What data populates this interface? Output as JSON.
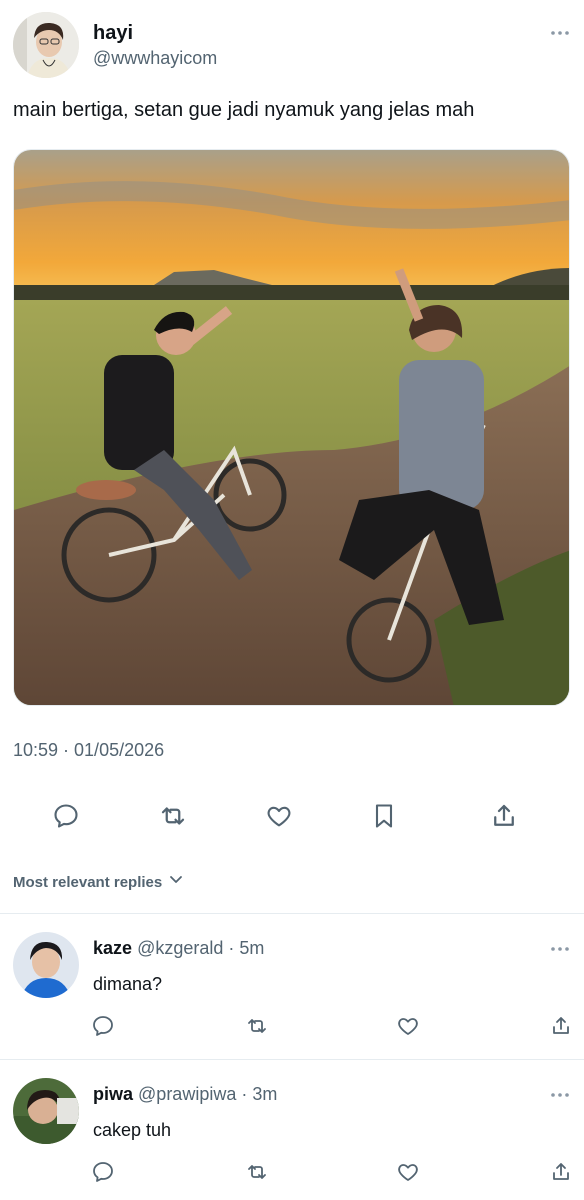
{
  "tweet": {
    "author": {
      "name": "hayi",
      "handle": "@wwwhayicom"
    },
    "text": "main bertiga, setan gue jadi nyamuk yang jelas mah",
    "timestamp": "10:59 · 01/05/2026"
  },
  "actions": [
    "reply-icon",
    "retweet-icon",
    "like-icon",
    "bookmark-icon",
    "share-icon"
  ],
  "replies_sort": {
    "label": "Most relevant replies"
  },
  "replies": [
    {
      "name": "kaze",
      "handle": "@kzgerald",
      "separator": "·",
      "time": "5m",
      "text": "dimana?"
    },
    {
      "name": "piwa",
      "handle": "@prawipiwa",
      "separator": "·",
      "time": "3m",
      "text": "cakep tuh"
    }
  ],
  "colors": {
    "text": "#0f1419",
    "secondary": "#536471",
    "divider": "#e6ecf0"
  }
}
